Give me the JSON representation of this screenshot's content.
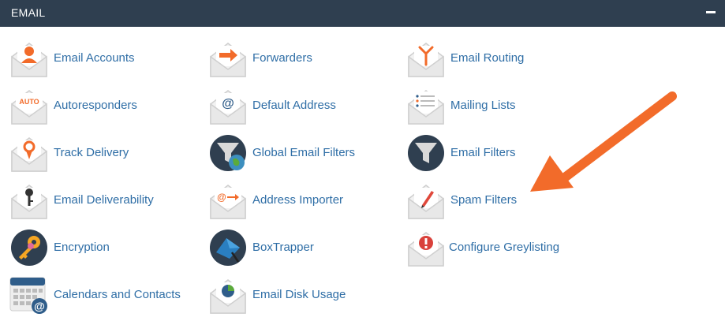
{
  "header": {
    "title": "EMAIL",
    "collapse_icon": "minus-icon"
  },
  "colors": {
    "header_bg": "#2f3f50",
    "link": "#2f6ea6",
    "accent": "#f26b2a"
  },
  "items": [
    {
      "label": "Email Accounts",
      "icon": "email-accounts-icon"
    },
    {
      "label": "Forwarders",
      "icon": "forwarders-icon"
    },
    {
      "label": "Email Routing",
      "icon": "email-routing-icon"
    },
    {
      "label": "Autoresponders",
      "icon": "autoresponders-icon",
      "icon_text": "AUTO"
    },
    {
      "label": "Default Address",
      "icon": "default-address-icon"
    },
    {
      "label": "Mailing Lists",
      "icon": "mailing-lists-icon"
    },
    {
      "label": "Track Delivery",
      "icon": "track-delivery-icon"
    },
    {
      "label": "Global Email Filters",
      "icon": "global-email-filters-icon"
    },
    {
      "label": "Email Filters",
      "icon": "email-filters-icon"
    },
    {
      "label": "Email Deliverability",
      "icon": "email-deliverability-icon"
    },
    {
      "label": "Address Importer",
      "icon": "address-importer-icon"
    },
    {
      "label": "Spam Filters",
      "icon": "spam-filters-icon"
    },
    {
      "label": "Encryption",
      "icon": "encryption-icon"
    },
    {
      "label": "BoxTrapper",
      "icon": "boxtrapper-icon"
    },
    {
      "label": "Configure Greylisting",
      "icon": "configure-greylisting-icon"
    },
    {
      "label": "Calendars and Contacts",
      "icon": "calendars-and-contacts-icon"
    },
    {
      "label": "Email Disk Usage",
      "icon": "email-disk-usage-icon"
    }
  ],
  "annotation": {
    "icon": "orange-arrow-icon",
    "points_to": "Spam Filters"
  }
}
